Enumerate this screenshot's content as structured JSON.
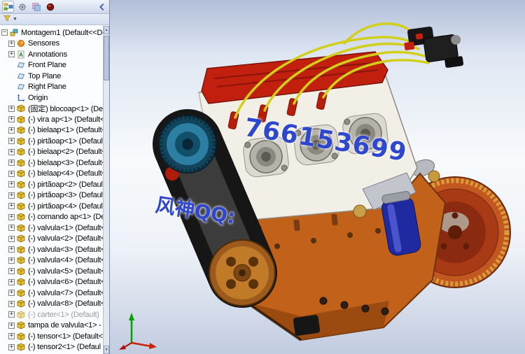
{
  "panel": {
    "tabs": [
      {
        "icon": "featuremanager-tree-icon"
      },
      {
        "icon": "propertymanager-icon"
      },
      {
        "icon": "configurationmanager-icon"
      },
      {
        "icon": "displaymanager-icon"
      }
    ],
    "filter_icon": "filter-icon",
    "filter_dropdown_icon": "chevron-down-icon",
    "collapse_icon": "collapse-panel-icon"
  },
  "tree": {
    "items": [
      {
        "label": "Montagem1  (Default<<De",
        "icon": "assembly-icon",
        "expander": "minus",
        "indent": 0
      },
      {
        "label": "Sensores",
        "icon": "sensors-folder-icon",
        "expander": "plus",
        "indent": 1
      },
      {
        "label": "Annotations",
        "icon": "annotations-folder-icon",
        "expander": "plus",
        "indent": 1
      },
      {
        "label": "Front Plane",
        "icon": "plane-icon",
        "expander": "none",
        "indent": 1
      },
      {
        "label": "Top Plane",
        "icon": "plane-icon",
        "expander": "none",
        "indent": 1
      },
      {
        "label": "Right Plane",
        "icon": "plane-icon",
        "expander": "none",
        "indent": 1
      },
      {
        "label": "Origin",
        "icon": "origin-icon",
        "expander": "none",
        "indent": 1
      },
      {
        "label": "(固定) blocoap<1> (Def",
        "icon": "part-icon",
        "expander": "plus",
        "indent": 1
      },
      {
        "label": "(-) vira ap<1> (Default<",
        "icon": "part-icon",
        "expander": "plus",
        "indent": 1
      },
      {
        "label": "(-) bielaap<1> (Default<",
        "icon": "part-icon",
        "expander": "plus",
        "indent": 1
      },
      {
        "label": "(-) pirtãoap<1> (Default<",
        "icon": "part-icon",
        "expander": "plus",
        "indent": 1
      },
      {
        "label": "(-) bielaap<2> (Default<",
        "icon": "part-icon",
        "expander": "plus",
        "indent": 1
      },
      {
        "label": "(-) bielaap<3> (Default<",
        "icon": "part-icon",
        "expander": "plus",
        "indent": 1
      },
      {
        "label": "(-) bielaap<4> (Default<",
        "icon": "part-icon",
        "expander": "plus",
        "indent": 1
      },
      {
        "label": "(-) pirtãoap<2> (Default<",
        "icon": "part-icon",
        "expander": "plus",
        "indent": 1
      },
      {
        "label": "(-) pirtãoap<3> (Default<",
        "icon": "part-icon",
        "expander": "plus",
        "indent": 1
      },
      {
        "label": "(-) pirtãoap<4> (Default<",
        "icon": "part-icon",
        "expander": "plus",
        "indent": 1
      },
      {
        "label": "(-) comando ap<1> (Default<",
        "icon": "part-icon",
        "expander": "plus",
        "indent": 1
      },
      {
        "label": "(-) valvula<1> (Default<",
        "icon": "part-icon",
        "expander": "plus",
        "indent": 1
      },
      {
        "label": "(-) valvula<2> (Default<",
        "icon": "part-icon",
        "expander": "plus",
        "indent": 1
      },
      {
        "label": "(-) valvula<3> (Default<",
        "icon": "part-icon",
        "expander": "plus",
        "indent": 1
      },
      {
        "label": "(-) valvula<4> (Default<",
        "icon": "part-icon",
        "expander": "plus",
        "indent": 1
      },
      {
        "label": "(-) valvula<5> (Default<",
        "icon": "part-icon",
        "expander": "plus",
        "indent": 1
      },
      {
        "label": "(-) valvula<6> (Default<",
        "icon": "part-icon",
        "expander": "plus",
        "indent": 1
      },
      {
        "label": "(-) valvula<7> (Default<",
        "icon": "part-icon",
        "expander": "plus",
        "indent": 1
      },
      {
        "label": "(-) valvula<8> (Default<",
        "icon": "part-icon",
        "expander": "plus",
        "indent": 1
      },
      {
        "label": "(-) carter<1> (Default)",
        "icon": "part-icon",
        "expander": "plus",
        "indent": 1,
        "grayed": true
      },
      {
        "label": "tampa de valvula<1> -",
        "icon": "part-icon",
        "expander": "plus",
        "indent": 1
      },
      {
        "label": "(-) tensor<1> (Default<",
        "icon": "part-icon",
        "expander": "plus",
        "indent": 1
      },
      {
        "label": "(-) tensor2<1> (Defaul",
        "icon": "part-icon",
        "expander": "plus",
        "indent": 1
      }
    ]
  },
  "watermark": {
    "qq_label": "风神QQ:",
    "qq_number": "766153699",
    "color": "#2f47cc"
  },
  "viewport": {
    "triad_axis_colors": {
      "x": "#cc2200",
      "y": "#00a000",
      "z": "#aa1100"
    }
  }
}
